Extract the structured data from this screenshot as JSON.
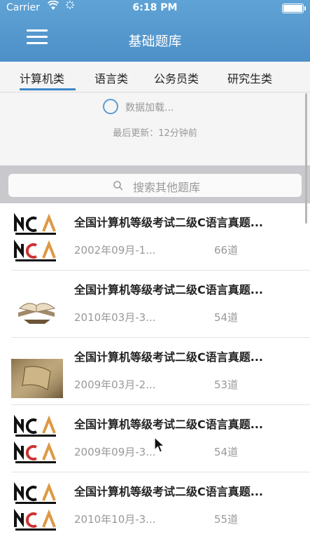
{
  "status_bar": {
    "carrier": "Carrier",
    "time": "6:18 PM"
  },
  "nav": {
    "title": "基础题库"
  },
  "tabs": [
    {
      "label": "计算机类",
      "selected": true
    },
    {
      "label": "语言类",
      "selected": false
    },
    {
      "label": "公务员类",
      "selected": false
    },
    {
      "label": "研究生类",
      "selected": false
    }
  ],
  "refresh": {
    "loading_text": "数据加载...",
    "last_updated": "最后更新：12分钟前"
  },
  "search": {
    "placeholder": "搜索其他题库"
  },
  "items": [
    {
      "title": "全国计算机等级考试二级C语言真题...",
      "date": "2002年09月-1...",
      "count": "66道",
      "thumb": "ncre-logo"
    },
    {
      "title": "全国计算机等级考试二级C语言真题...",
      "date": "2010年03月-3...",
      "count": "54道",
      "thumb": "book-photo"
    },
    {
      "title": "全国计算机等级考试二级C语言真题...",
      "date": "2009年03月-2...",
      "count": "53道",
      "thumb": "old-book-photo"
    },
    {
      "title": "全国计算机等级考试二级C语言真题...",
      "date": "2009年09月-3...",
      "count": "54道",
      "thumb": "ncre-logo"
    },
    {
      "title": "全国计算机等级考试二级C语言真题...",
      "date": "2010年10月-3...",
      "count": "55道",
      "thumb": "ncre-logo"
    }
  ],
  "colors": {
    "nav_bar": "#5fa3d6",
    "tab_indicator": "#3d86c6",
    "search_area": "#c9c9cd"
  }
}
